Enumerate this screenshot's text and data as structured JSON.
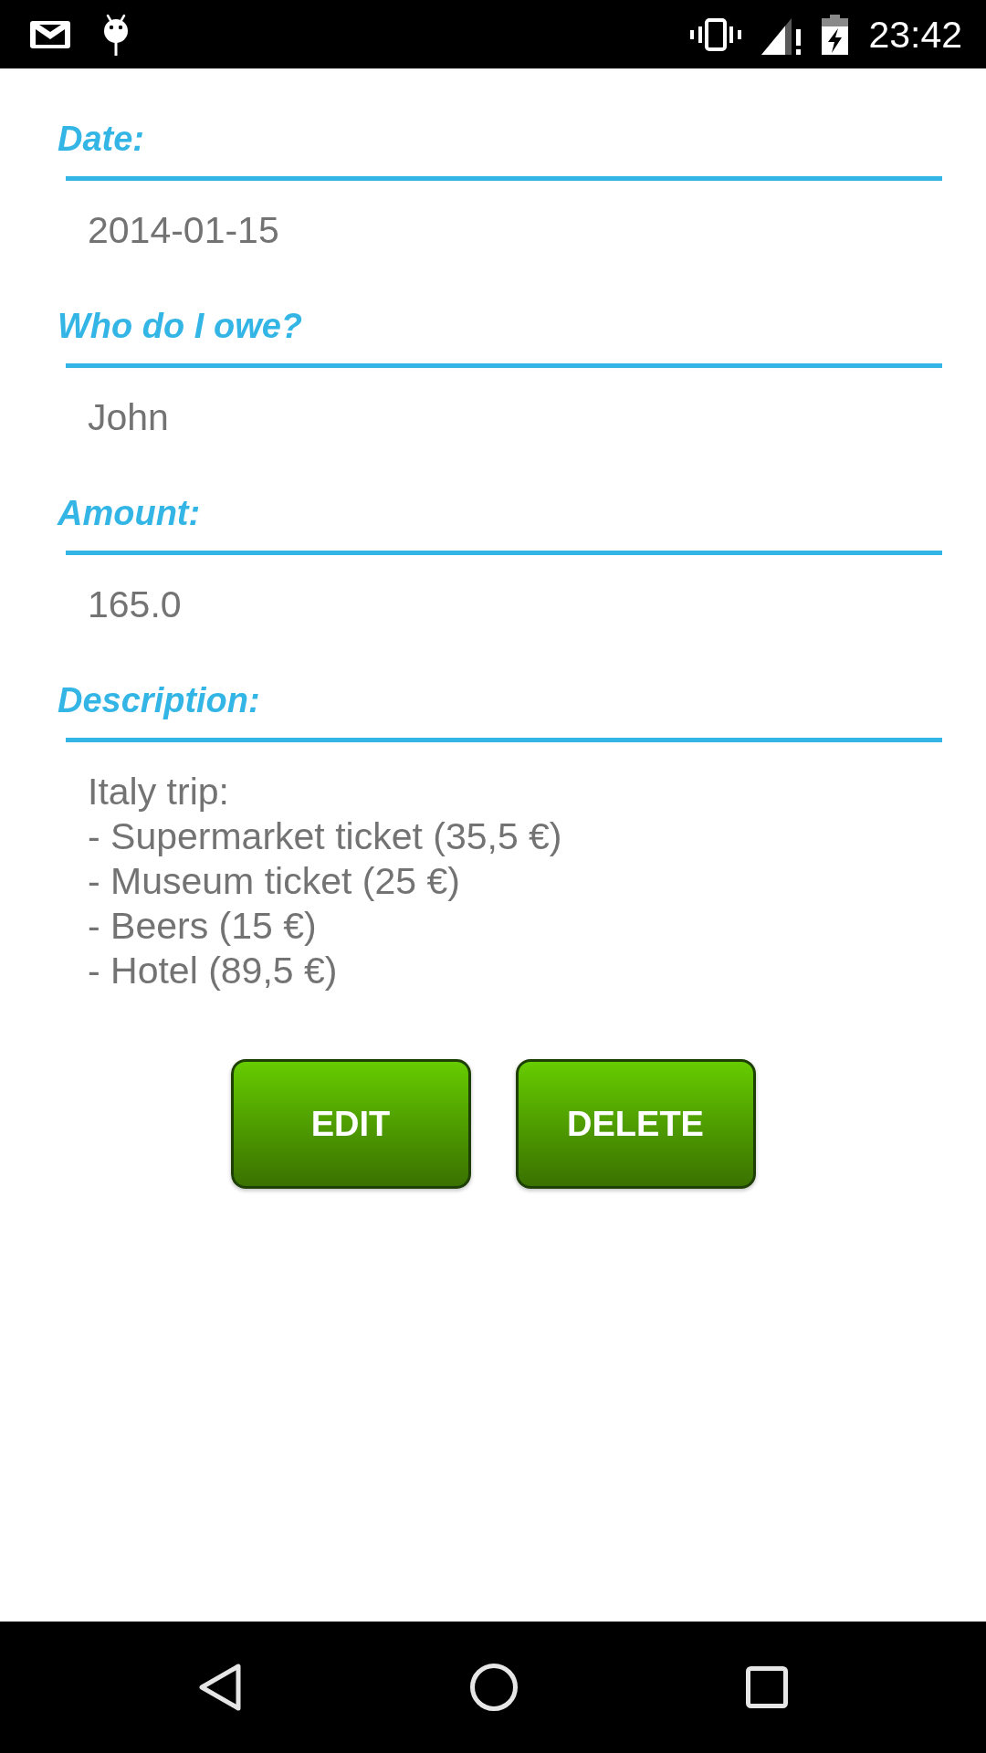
{
  "status_bar": {
    "time": "23:42"
  },
  "fields": [
    {
      "label": "Date:",
      "value": "2014-01-15"
    },
    {
      "label": "Who do I owe?",
      "value": "John"
    },
    {
      "label": "Amount:",
      "value": "165.0"
    },
    {
      "label": "Description:",
      "value": "Italy trip:\n- Supermarket ticket (35,5 €)\n- Museum ticket (25 €)\n- Beers (15 €)\n- Hotel (89,5 €)"
    }
  ],
  "buttons": [
    {
      "label": "EDIT"
    },
    {
      "label": "DELETE"
    }
  ]
}
